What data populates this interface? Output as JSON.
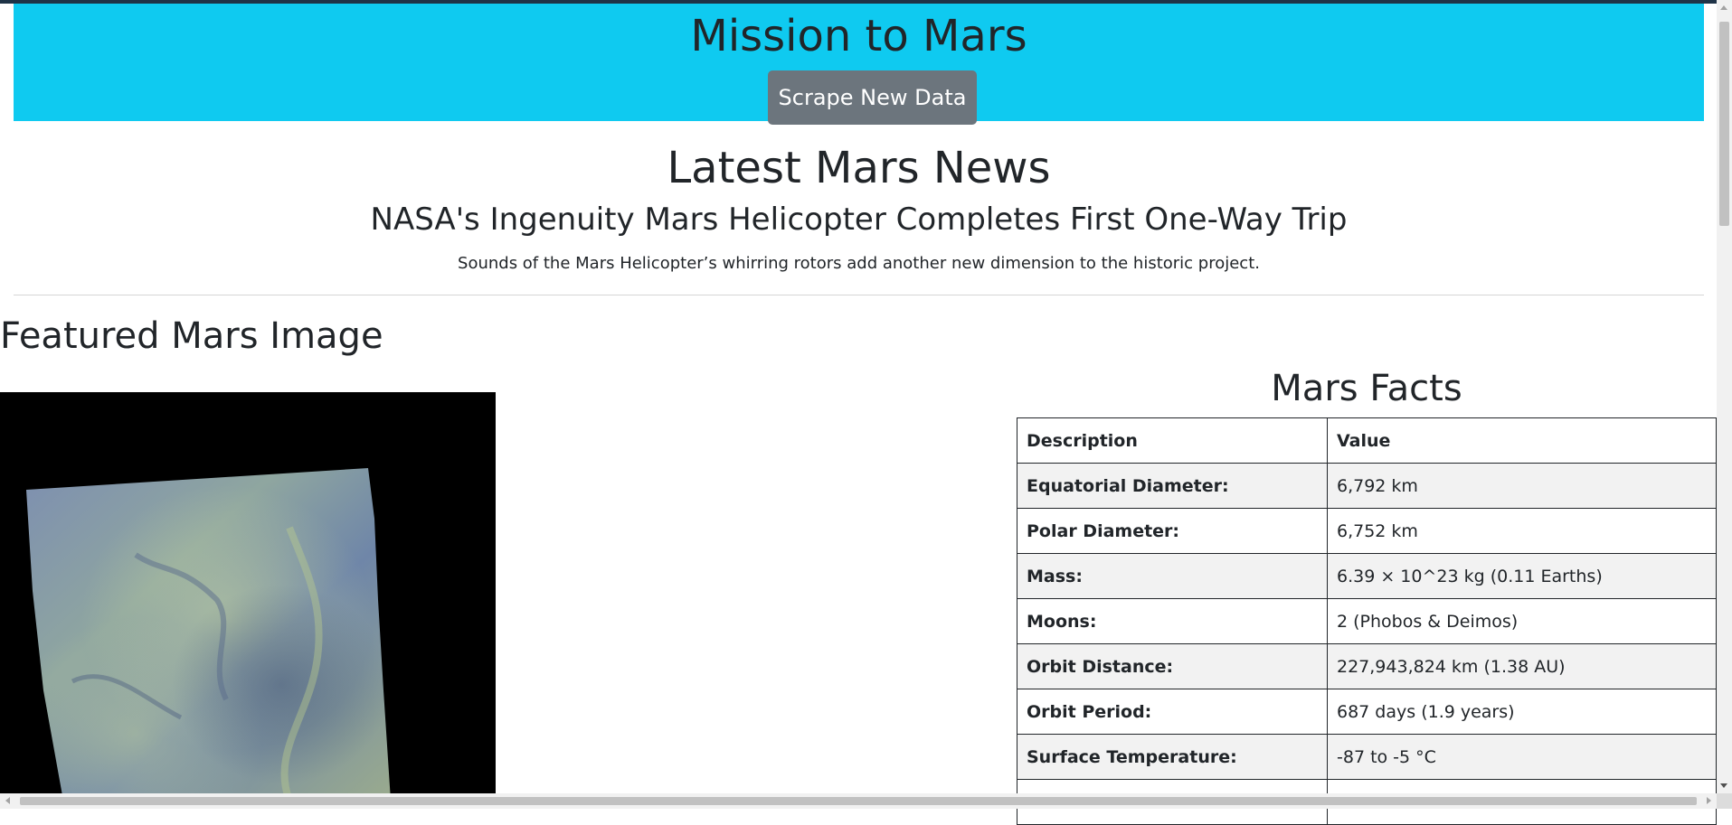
{
  "header": {
    "title": "Mission to Mars",
    "scrape_button_label": "Scrape New Data"
  },
  "news": {
    "section_title": "Latest Mars News",
    "headline": "NASA's Ingenuity Mars Helicopter Completes First One-Way Trip",
    "teaser": "Sounds of the Mars Helicopter’s whirring rotors add another new dimension to the historic project."
  },
  "featured": {
    "section_title": "Featured Mars Image"
  },
  "facts": {
    "section_title": "Mars Facts",
    "columns": [
      "Description",
      "Value"
    ],
    "rows": [
      {
        "label": "Equatorial Diameter:",
        "value": "6,792 km"
      },
      {
        "label": "Polar Diameter:",
        "value": "6,752 km"
      },
      {
        "label": "Mass:",
        "value": "6.39 × 10^23 kg (0.11 Earths)"
      },
      {
        "label": "Moons:",
        "value": "2 (Phobos & Deimos)"
      },
      {
        "label": "Orbit Distance:",
        "value": "227,943,824 km (1.38 AU)"
      },
      {
        "label": "Orbit Period:",
        "value": "687 days (1.9 years)"
      },
      {
        "label": "Surface Temperature:",
        "value": "-87 to -5 °C"
      },
      {
        "label": "",
        "value": ""
      }
    ]
  },
  "colors": {
    "jumbotron_bg": "#0fcaf0",
    "button_bg": "#6c757d",
    "text": "#212529",
    "striped_row": "#f2f2f2"
  }
}
